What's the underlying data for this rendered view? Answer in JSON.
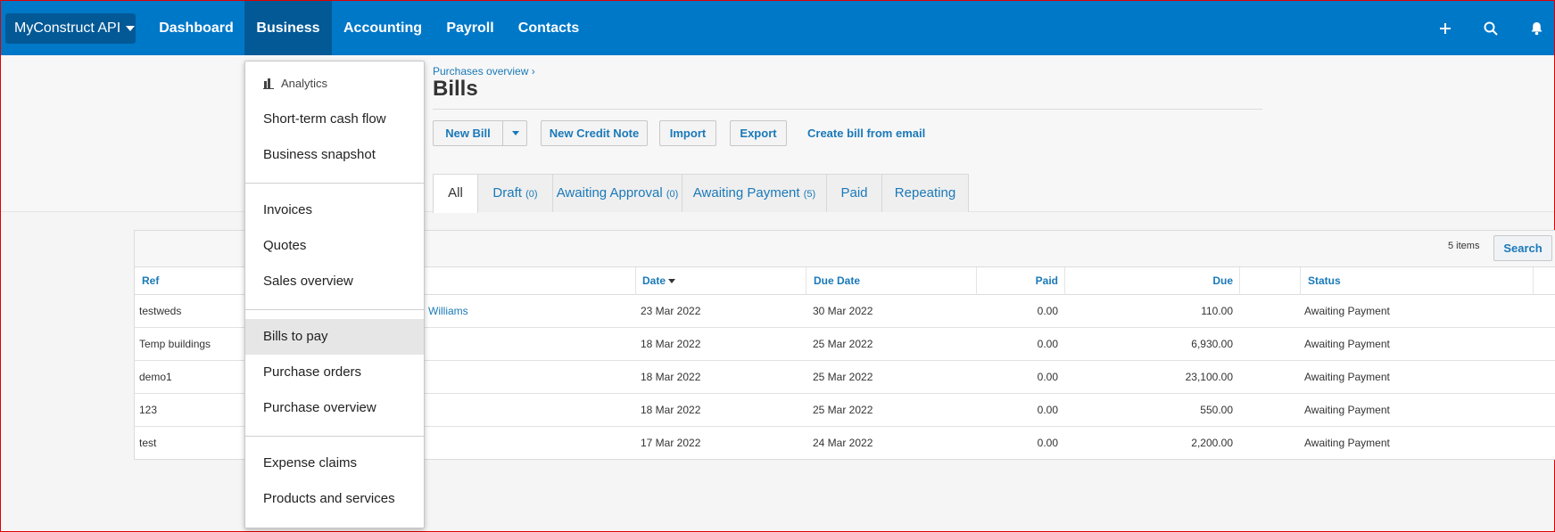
{
  "nav": {
    "org": "MyConstruct API",
    "items": [
      "Dashboard",
      "Business",
      "Accounting",
      "Payroll",
      "Contacts"
    ],
    "active": "Business",
    "icons": [
      "plus-icon",
      "search-icon",
      "bell-icon"
    ]
  },
  "header": {
    "breadcrumb": "Purchases overview ›",
    "title": "Bills",
    "buttons": {
      "new_bill": "New Bill",
      "new_credit_note": "New Credit Note",
      "import": "Import",
      "export": "Export",
      "create_from_email": "Create bill from email"
    }
  },
  "tabs": [
    {
      "label": "All",
      "count": ""
    },
    {
      "label": "Draft",
      "count": "(0)"
    },
    {
      "label": "Awaiting Approval",
      "count": "(0)"
    },
    {
      "label": "Awaiting Payment",
      "count": "(5)"
    },
    {
      "label": "Paid",
      "count": ""
    },
    {
      "label": "Repeating",
      "count": ""
    }
  ],
  "table": {
    "items_count": "5 items",
    "search_label": "Search",
    "columns": {
      "ref": "Ref",
      "date": "Date",
      "due_date": "Due Date",
      "paid": "Paid",
      "due": "Due",
      "status": "Status"
    },
    "rows": [
      {
        "ref": "testweds",
        "to": "Williams",
        "date": "23 Mar 2022",
        "due_date": "30 Mar 2022",
        "paid": "0.00",
        "due": "110.00",
        "status": "Awaiting Payment"
      },
      {
        "ref": "Temp buildings",
        "to": "",
        "date": "18 Mar 2022",
        "due_date": "25 Mar 2022",
        "paid": "0.00",
        "due": "6,930.00",
        "status": "Awaiting Payment"
      },
      {
        "ref": "demo1",
        "to": "",
        "date": "18 Mar 2022",
        "due_date": "25 Mar 2022",
        "paid": "0.00",
        "due": "23,100.00",
        "status": "Awaiting Payment"
      },
      {
        "ref": "123",
        "to": "",
        "date": "18 Mar 2022",
        "due_date": "25 Mar 2022",
        "paid": "0.00",
        "due": "550.00",
        "status": "Awaiting Payment"
      },
      {
        "ref": "test",
        "to": "",
        "date": "17 Mar 2022",
        "due_date": "24 Mar 2022",
        "paid": "0.00",
        "due": "2,200.00",
        "status": "Awaiting Payment"
      }
    ]
  },
  "dropdown": {
    "analytics_label": "Analytics",
    "groups": [
      [
        "Short-term cash flow",
        "Business snapshot"
      ],
      [
        "Invoices",
        "Quotes",
        "Sales overview"
      ],
      [
        "Bills to pay",
        "Purchase orders",
        "Purchase overview"
      ],
      [
        "Expense claims",
        "Products and services"
      ]
    ],
    "highlighted": "Bills to pay"
  },
  "colors": {
    "nav_bg": "#0078c8",
    "nav_active": "#035996",
    "link": "#1a79b9"
  }
}
